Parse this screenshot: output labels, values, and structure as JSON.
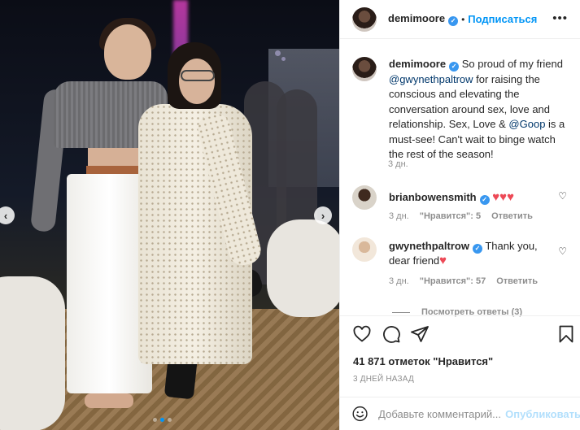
{
  "post": {
    "author": "demimoore",
    "follow_label": "Подписаться",
    "separator": "•",
    "more_glyph": "•••",
    "image": {
      "carousel_dots": 3,
      "active_dot": 1,
      "prev_glyph": "‹",
      "next_glyph": "›"
    }
  },
  "caption": {
    "author": "demimoore",
    "text_1": "So proud of my friend ",
    "mention_1": "@gwynethpaltrow",
    "text_2": " for raising the conscious and elevating the conversation around sex, love and relationship. Sex, Love & ",
    "mention_2": "@Goop",
    "text_3": " is a must-see! Can't wait to binge watch the rest of the season!",
    "time": "3 дн."
  },
  "comments": [
    {
      "author": "brianbowensmith",
      "text": "",
      "hearts": "♥♥♥",
      "time": "3 дн.",
      "likes_label": "\"Нравится\": 5",
      "reply_label": "Ответить"
    },
    {
      "author": "gwynethpaltrow",
      "text": "Thank you, dear friend",
      "hearts": "♥",
      "time": "3 дн.",
      "likes_label": "\"Нравится\": 57",
      "reply_label": "Ответить"
    }
  ],
  "view_replies": "Посмотреть ответы (3)",
  "likes_text": "41 871 отметок \"Нравится\"",
  "date_text": "3 ДНЕЙ НАЗАД",
  "add_comment": {
    "placeholder": "Добавьте комментарий...",
    "publish_label": "Опубликовать"
  },
  "colors": {
    "link_blue": "#0095f6",
    "verified_blue": "#3897f0",
    "heart_red": "#ed4956",
    "muted_gray": "#8e8e8e"
  },
  "icons": [
    "heart-icon",
    "comment-icon",
    "share-icon",
    "bookmark-icon",
    "emoji-icon",
    "verified-badge-icon"
  ]
}
